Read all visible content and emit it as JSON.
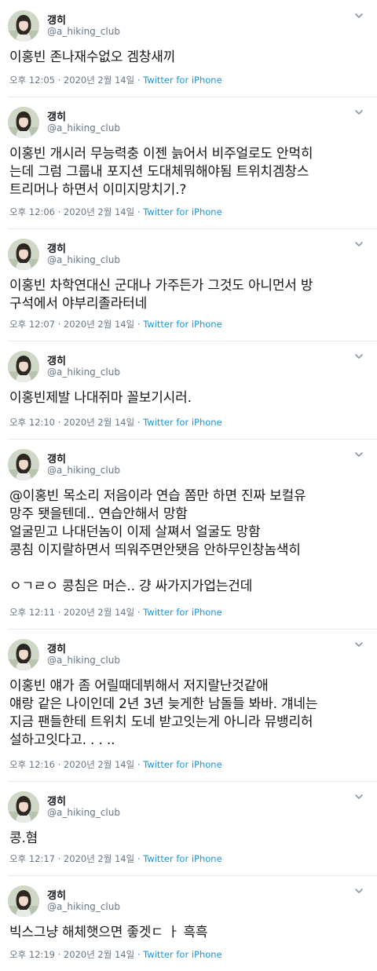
{
  "tweets": [
    {
      "name": "갱히",
      "handle": "@a_hiking_club",
      "text": "이홍빈 존나재수없오 겜창새끼",
      "time": "오후 12:05 · 2020년 2월 14일 · ",
      "source": "Twitter for iPhone"
    },
    {
      "name": "갱히",
      "handle": "@a_hiking_club",
      "text": "이홍빈 개시러 무능력충 이젠 늙어서 비주얼로도 안먹히\n는데 그럼 그룹내 포지션 도대체뭐해야됨 트위치겜창스\n트리머나 하면서 이미지망치기.?",
      "time": "오후 12:06 · 2020년 2월 14일 · ",
      "source": "Twitter for iPhone"
    },
    {
      "name": "갱히",
      "handle": "@a_hiking_club",
      "text": "이홍빈 차학연대신 군대나 가주든가 그것도 아니먼서 방\n구석에서 야부리졸라터네",
      "time": "오후 12:07 · 2020년 2월 14일 · ",
      "source": "Twitter for iPhone"
    },
    {
      "name": "갱히",
      "handle": "@a_hiking_club",
      "text": "이홍빈제발 나대쥐마 꼴보기시러.",
      "time": "오후 12:10 · 2020년 2월 14일 · ",
      "source": "Twitter for iPhone"
    },
    {
      "name": "갱히",
      "handle": "@a_hiking_club",
      "text": "@이홍빈 목소리 저음이라 연습 쫌만 하면 진짜 보컬유\n망주 됏을텐데.. 연습안해서 망함\n얼굴믿고 나대던놈이 이제 살쪄서 얼굴도 망함\n콩침 이지랄하면서 띄워주면안됏음 안하무인창놈색히\n\nㅇㄱㄹㅇ 콩침은 머슨.. 걍 싸가지가업는건데",
      "time": "오후 12:11 · 2020년 2월 14일 · ",
      "source": "Twitter for iPhone"
    },
    {
      "name": "갱히",
      "handle": "@a_hiking_club",
      "text": "이홍빈 얘가 좀 어릴때데뷔해서 저지랄난것같애\n얘랑 같은 나이인데 2년 3년 늦게한 남돌들 봐바. 걔네는\n지금 팬들한테 트위치 도네 받고잇는게 아니라 뮤뱅리허\n설하고잇다고. . . ..",
      "time": "오후 12:16 · 2020년 2월 14일 · ",
      "source": "Twitter for iPhone"
    },
    {
      "name": "갱히",
      "handle": "@a_hiking_club",
      "text": "콩.혐",
      "time": "오후 12:17 · 2020년 2월 14일 · ",
      "source": "Twitter for iPhone"
    },
    {
      "name": "갱히",
      "handle": "@a_hiking_club",
      "text": "빅스그냥 해체햇으면 좋겟ㄷ ㅏ 흑흑",
      "time": "오후 12:19 · 2020년 2월 14일 · ",
      "source": "Twitter for iPhone"
    }
  ]
}
